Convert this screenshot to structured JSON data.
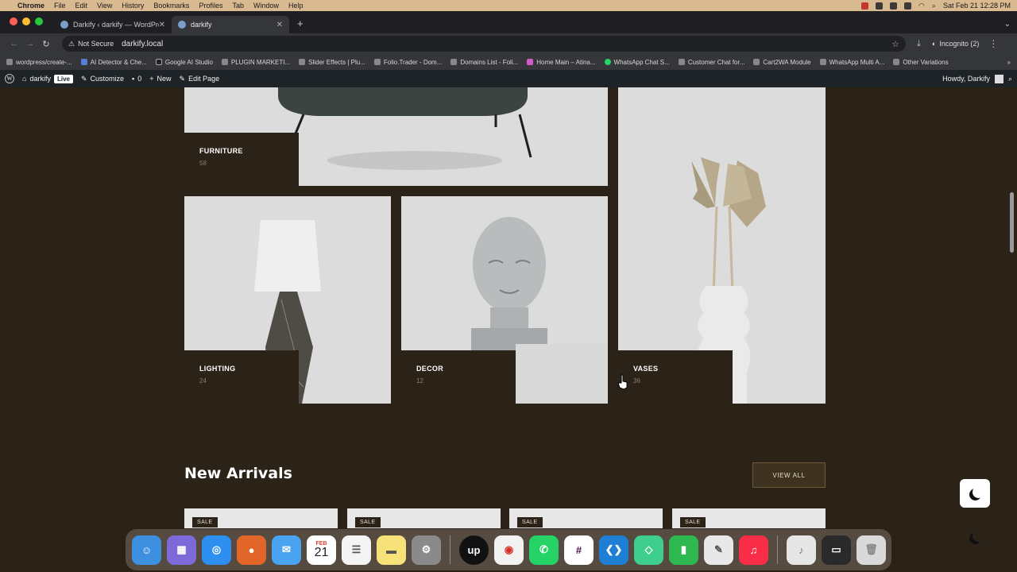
{
  "menubar": {
    "app": "Chrome",
    "items": [
      "File",
      "Edit",
      "View",
      "History",
      "Bookmarks",
      "Profiles",
      "Tab",
      "Window",
      "Help"
    ],
    "datetime": "Sat Feb 21  12:28 PM"
  },
  "tabs": [
    {
      "label": "Darkify ‹ darkify — WordPres"
    },
    {
      "label": "darkify"
    }
  ],
  "address": {
    "security": "Not Secure",
    "url": "darkify.local",
    "incognito": "Incognito (2)"
  },
  "bookmarks": [
    "wordpress/create-...",
    "AI Detector & Che...",
    "Google AI Studio",
    "PLUGIN MARKETI...",
    "Slider Effects | Plu...",
    "Folio.Trader - Dom...",
    "Domains List - Foli...",
    "Home Main – Atina...",
    "WhatsApp Chat S...",
    "Customer Chat for...",
    "Cart2WA Module",
    "WhatsApp Multi A...",
    "Other Variations"
  ],
  "wpbar": {
    "site": "darkify",
    "live": "Live",
    "customize": "Customize",
    "comments": "0",
    "new": "New",
    "edit": "Edit Page",
    "howdy": "Howdy, Darkify"
  },
  "categories": [
    {
      "name": "FURNITURE",
      "count": "58"
    },
    {
      "name": "LIGHTING",
      "count": "24"
    },
    {
      "name": "DECOR",
      "count": "12"
    },
    {
      "name": "VASES",
      "count": "36"
    }
  ],
  "new_arrivals": {
    "title": "New Arrivals",
    "view_all": "VIEW ALL",
    "badges": [
      "SALE",
      "SALE",
      "SALE",
      "SALE"
    ]
  },
  "dock": {
    "calendar_month": "FEB",
    "calendar_day": "21"
  },
  "colors": {
    "page_bg": "#2b2317",
    "card_bg": "#dcdcdc",
    "menubar_bg": "#d9b98f",
    "wp_admin_bar": "#1d2327"
  }
}
